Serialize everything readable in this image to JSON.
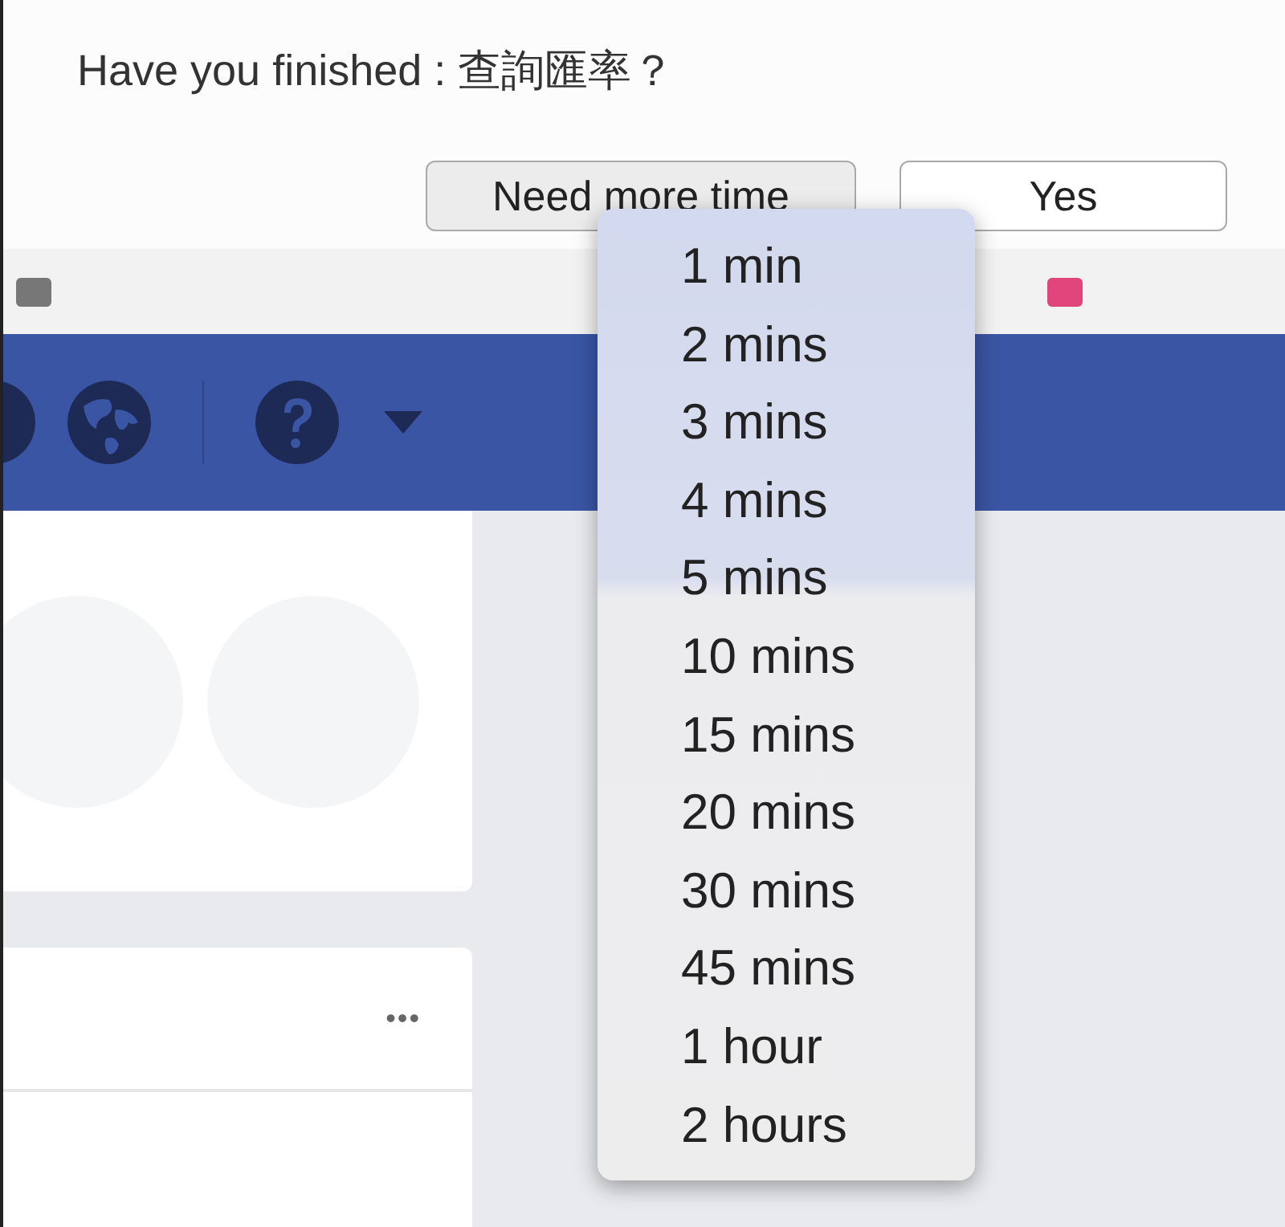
{
  "dialog": {
    "title": "Have you finished : 查詢匯率？",
    "buttons": [
      {
        "label": "Need more time",
        "kind": "menu"
      },
      {
        "label": "Yes",
        "kind": "plain"
      }
    ]
  },
  "time_menu": {
    "items": [
      {
        "label": "1 min"
      },
      {
        "label": "2 mins"
      },
      {
        "label": "3 mins"
      },
      {
        "label": "4 mins"
      },
      {
        "label": "5 mins"
      },
      {
        "label": "10 mins"
      },
      {
        "label": "15 mins"
      },
      {
        "label": "20 mins"
      },
      {
        "label": "30 mins"
      },
      {
        "label": "45 mins"
      },
      {
        "label": "1 hour"
      },
      {
        "label": "2 hours"
      }
    ]
  },
  "card": {
    "more": "•••"
  }
}
